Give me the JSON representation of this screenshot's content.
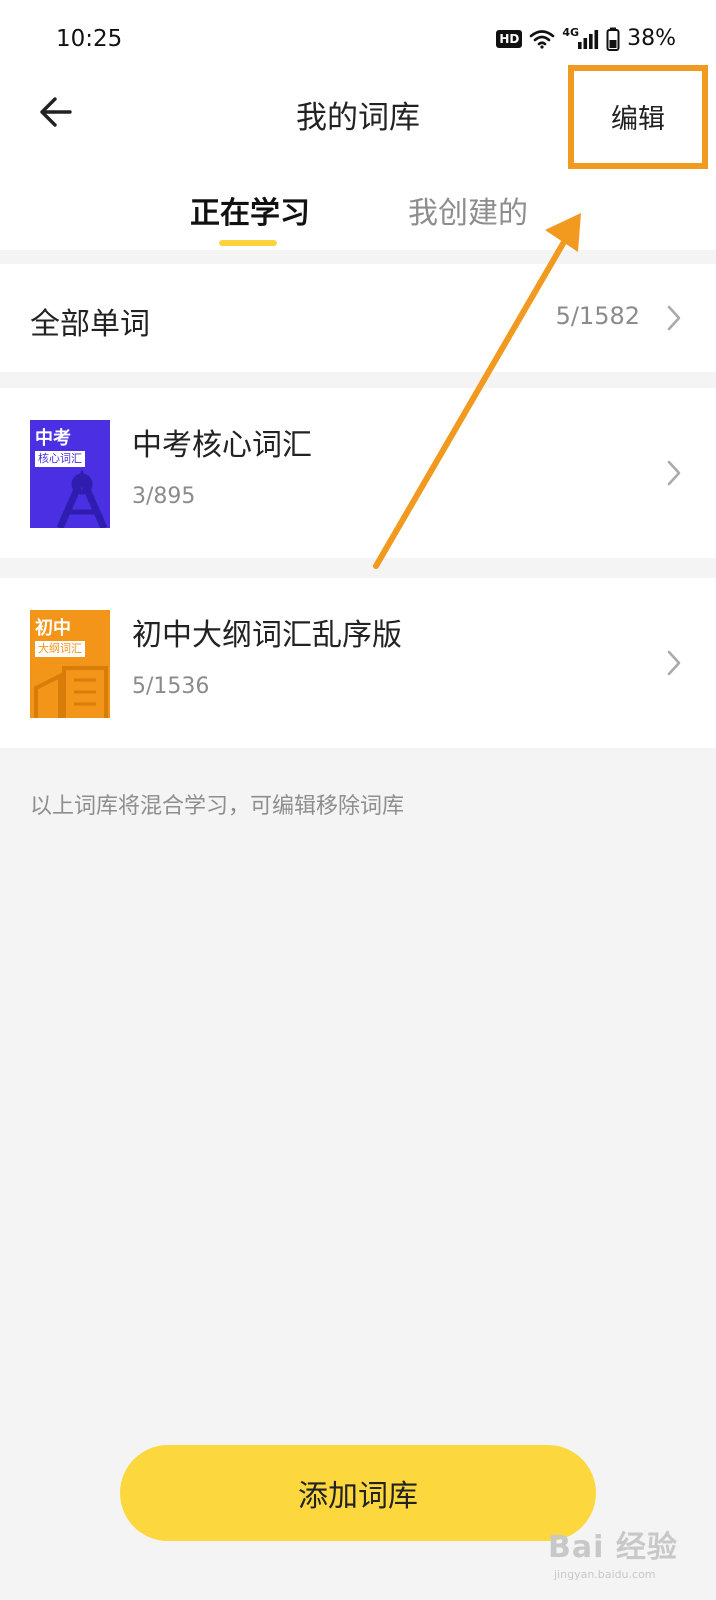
{
  "status_bar": {
    "time": "10:25",
    "hd": "HD",
    "network": "4G",
    "battery": "38%",
    "icons": [
      "hd-icon",
      "wifi-icon",
      "signal-icon",
      "battery-icon"
    ]
  },
  "header": {
    "title": "我的词库",
    "edit_label": "编辑",
    "back_icon": "back-arrow-icon"
  },
  "tabs": [
    {
      "label": "正在学习",
      "active": true
    },
    {
      "label": "我创建的",
      "active": false
    }
  ],
  "all_words": {
    "label": "全部单词",
    "count": "5/1582"
  },
  "books": [
    {
      "title": "中考核心词汇",
      "count": "3/895",
      "cover_title": "中考",
      "cover_subtitle": "核心词汇",
      "cover_color": "#4a2fe3"
    },
    {
      "title": "初中大纲词汇乱序版",
      "count": "5/1536",
      "cover_title": "初中",
      "cover_subtitle": "大纲词汇",
      "cover_color": "#f29518"
    }
  ],
  "hint": "以上词库将混合学习，可编辑移除词库",
  "add_button_label": "添加词库",
  "annotation": {
    "arrow_color": "#f29a1f",
    "highlight_color": "#f29a1f"
  },
  "watermark": {
    "main": "Bai 经验",
    "sub": "jingyan.baidu.com"
  },
  "colors": {
    "accent_yellow": "#fcd83e",
    "background": "#f4f4f4"
  }
}
